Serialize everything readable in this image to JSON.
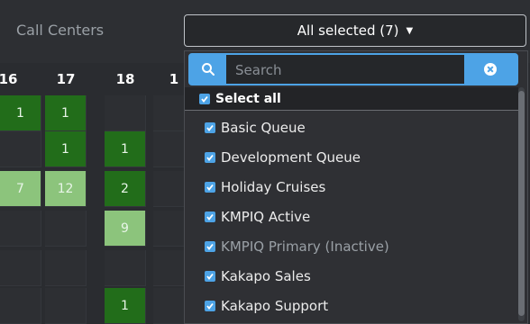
{
  "header": {
    "call_centers_label": "Call Centers",
    "selector_label": "All selected (7)"
  },
  "grid": {
    "columns": [
      "16",
      "17",
      "18",
      "1"
    ],
    "rows": [
      [
        "1",
        "1",
        "",
        ""
      ],
      [
        "",
        "1",
        "1",
        ""
      ],
      [
        "7",
        "12",
        "2",
        ""
      ],
      [
        "",
        "",
        "9",
        ""
      ],
      [
        "",
        "",
        "",
        ""
      ],
      [
        "",
        "",
        "1",
        ""
      ]
    ]
  },
  "dropdown": {
    "search_placeholder": "Search",
    "select_all_label": "Select all",
    "options": [
      {
        "label": "Basic Queue",
        "checked": true,
        "inactive": false
      },
      {
        "label": "Development Queue",
        "checked": true,
        "inactive": false
      },
      {
        "label": "Holiday Cruises",
        "checked": true,
        "inactive": false
      },
      {
        "label": "KMPIQ Active",
        "checked": true,
        "inactive": false
      },
      {
        "label": "KMPIQ Primary (Inactive)",
        "checked": true,
        "inactive": true
      },
      {
        "label": "Kakapo Sales",
        "checked": true,
        "inactive": false
      },
      {
        "label": "Kakapo Support",
        "checked": true,
        "inactive": false
      }
    ]
  },
  "colors": {
    "accent": "#4da3e6",
    "heat_dark": "#226d1a",
    "heat_light": "#8cc47c",
    "background": "#2a2c30"
  }
}
